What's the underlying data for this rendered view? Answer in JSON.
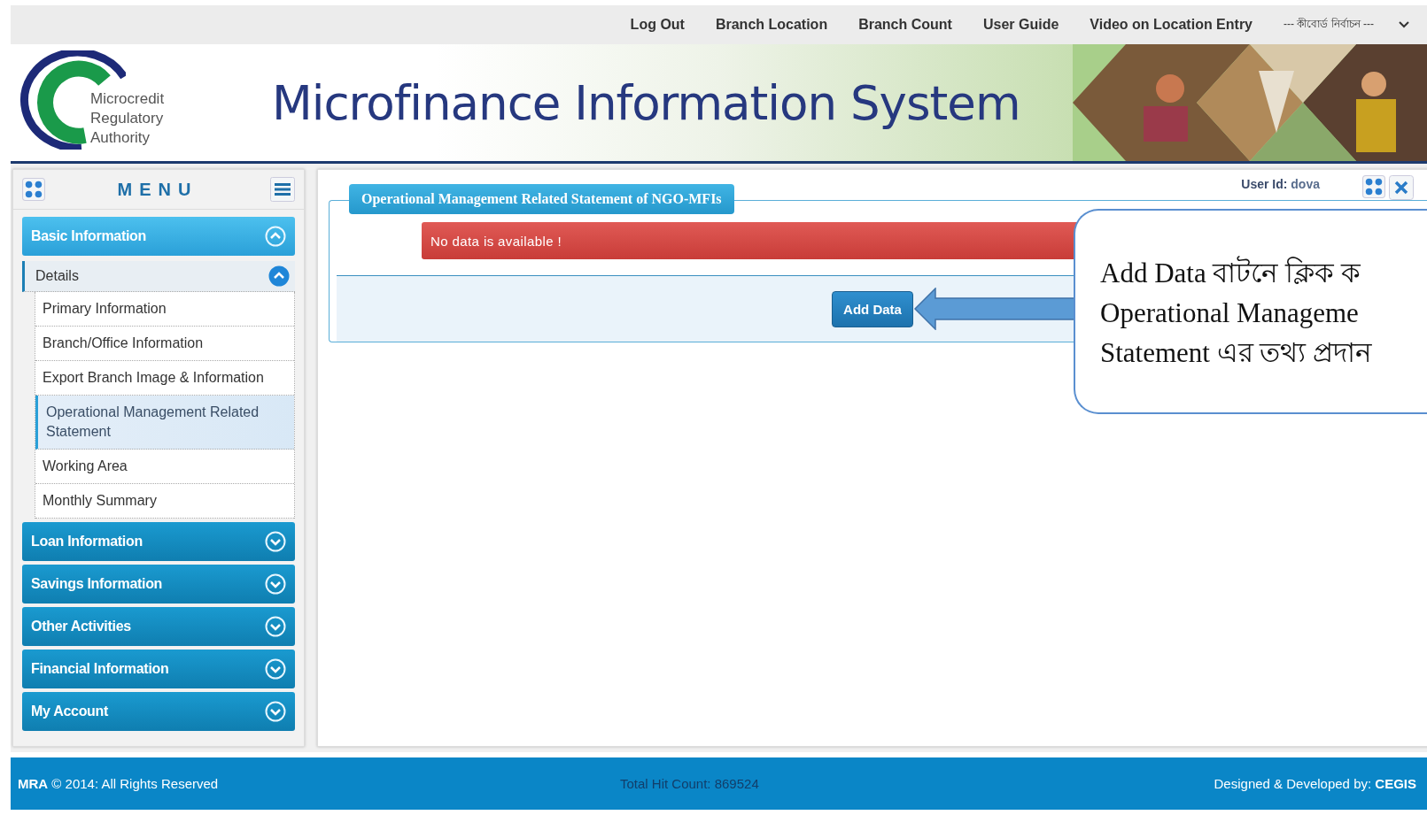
{
  "top_links": [
    {
      "label": "Log Out"
    },
    {
      "label": "Branch Location"
    },
    {
      "label": "Branch Count"
    },
    {
      "label": "User Guide"
    },
    {
      "label": "Video on Location Entry"
    }
  ],
  "keyboard_select": {
    "value": "--- কীবোর্ড নির্বাচন ---"
  },
  "header": {
    "logo_lines": [
      "Microcredit",
      "Regulatory",
      "Authority"
    ],
    "title": "Microfinance Information System"
  },
  "menu": {
    "title": "MENU",
    "sections": [
      {
        "label": "Basic Information",
        "expanded": true,
        "children": [
          {
            "label": "Details",
            "expanded": true,
            "children": [
              {
                "label": "Primary Information",
                "selected": false
              },
              {
                "label": "Branch/Office Information",
                "selected": false
              },
              {
                "label": "Export Branch Image & Information",
                "selected": false
              },
              {
                "label": "Operational Management Related Statement",
                "selected": true
              },
              {
                "label": "Working Area",
                "selected": false
              },
              {
                "label": "Monthly Summary",
                "selected": false
              }
            ]
          }
        ]
      },
      {
        "label": "Loan Information",
        "expanded": false
      },
      {
        "label": "Savings Information",
        "expanded": false
      },
      {
        "label": "Other Activities",
        "expanded": false
      },
      {
        "label": "Financial Information",
        "expanded": false
      },
      {
        "label": "My Account",
        "expanded": false
      }
    ]
  },
  "panel": {
    "user_id_label": "User Id:",
    "user_id": "dova",
    "legend": "Operational Management Related Statement of NGO-MFIs",
    "alert": "No data is available !",
    "button": "Add Data"
  },
  "callout": {
    "lines": [
      "Add Data বাটনে ক্লিক ক",
      "Operational Manageme",
      "Statement এর তথ্য প্রদান"
    ]
  },
  "footer": {
    "left": "**MRA** © 2014: All Rights Reserved",
    "center": "Total Hit Count: 869524",
    "right": "Designed & Developed by: **CEGIS**"
  }
}
